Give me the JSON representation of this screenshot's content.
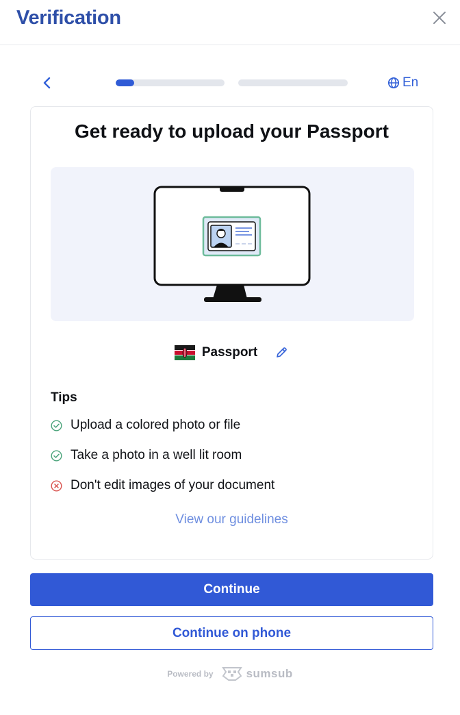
{
  "header": {
    "title": "Verification",
    "close_icon": "close-icon"
  },
  "nav": {
    "back_icon": "chevron-left-icon",
    "steps": [
      {
        "progress": 0.17
      },
      {
        "progress": 0
      }
    ],
    "language_icon": "globe-icon",
    "language": "En"
  },
  "card": {
    "title": "Get ready to upload your Passport",
    "illustration_icon": "monitor-passport-illustration",
    "document": {
      "flag_icon": "kenya-flag-icon",
      "label": "Passport",
      "edit_icon": "pencil-icon"
    },
    "tips": {
      "heading": "Tips",
      "items": [
        {
          "text": "Upload a colored photo or file",
          "status": "do",
          "icon": "check-circle-icon"
        },
        {
          "text": "Take a photo in a well lit room",
          "status": "do",
          "icon": "check-circle-icon"
        },
        {
          "text": "Don't edit images of your document",
          "status": "dont",
          "icon": "x-circle-icon"
        }
      ]
    },
    "guidelines_link": "View our guidelines"
  },
  "actions": {
    "continue": "Continue",
    "continue_on_phone": "Continue on phone"
  },
  "footer": {
    "powered_by": "Powered by",
    "brand": "sumsub",
    "brand_icon": "sumsub-logo-icon"
  },
  "colors": {
    "accent": "#3159d6",
    "title": "#2e4fa8",
    "link": "#6f8fe0",
    "success": "#4aa37a",
    "error": "#d9534f",
    "illustration_bg": "#f1f3fb"
  }
}
